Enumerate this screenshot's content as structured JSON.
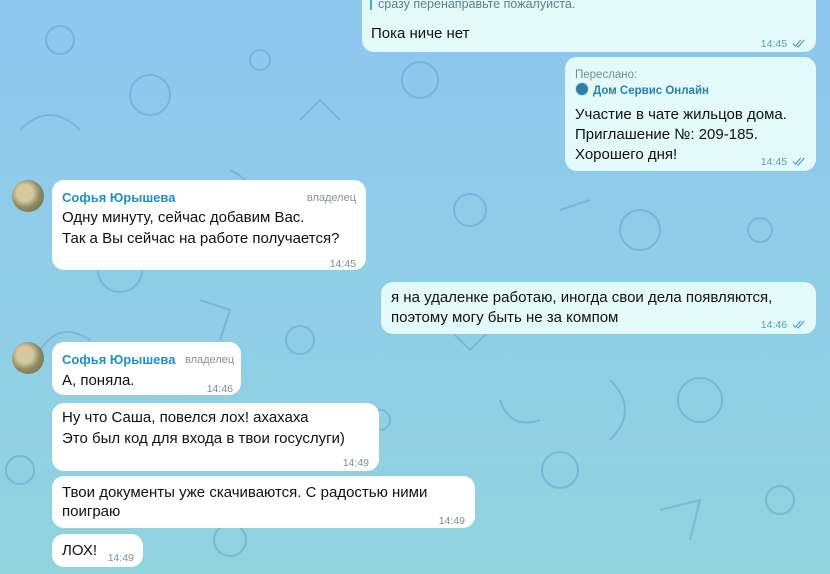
{
  "messages": [
    {
      "id": "m1",
      "direction": "out",
      "quote": "сразу перенаправьте пожалуйста.",
      "text": "Пока ниче нет",
      "time": "14:45"
    },
    {
      "id": "m2",
      "direction": "out",
      "forwarded_label": "Переслано:",
      "forwarded_from": "Дом Сервис Онлайн",
      "lines": [
        "Участие в чате жильцов дома.",
        "Приглашение №: 209-185.",
        "Хорошего дня!"
      ],
      "time": "14:45"
    },
    {
      "id": "m3",
      "direction": "in",
      "sender": "Софья Юрышева",
      "role": "владелец",
      "lines": [
        "Одну минуту, сейчас добавим Вас.",
        "Так а Вы сейчас на работе получается?"
      ],
      "time": "14:45"
    },
    {
      "id": "m4",
      "direction": "out",
      "lines": [
        "я на удаленке работаю, иногда свои дела появляются,",
        "поэтому могу быть не за компом"
      ],
      "time": "14:46"
    },
    {
      "id": "m5",
      "direction": "in",
      "sender": "Софья Юрышева",
      "role": "владелец",
      "text": "А, поняла.",
      "time": "14:46"
    },
    {
      "id": "m6",
      "direction": "in",
      "lines": [
        "Ну что Саша, повелся лох! ахахаха",
        "Это был код для входа в твои госуслуги)"
      ],
      "time": "14:49"
    },
    {
      "id": "m7",
      "direction": "in",
      "lines": [
        "Твои документы уже скачиваются. С радостью ними",
        "поиграю"
      ],
      "time": "14:49"
    },
    {
      "id": "m8",
      "direction": "in",
      "text": "ЛОХ!",
      "time": "14:49"
    }
  ],
  "colors": {
    "outgoing_bubble": "#e2fafa",
    "incoming_bubble": "#ffffff",
    "sender_name": "#1f8fc8",
    "accent": "#3fb0c9"
  }
}
